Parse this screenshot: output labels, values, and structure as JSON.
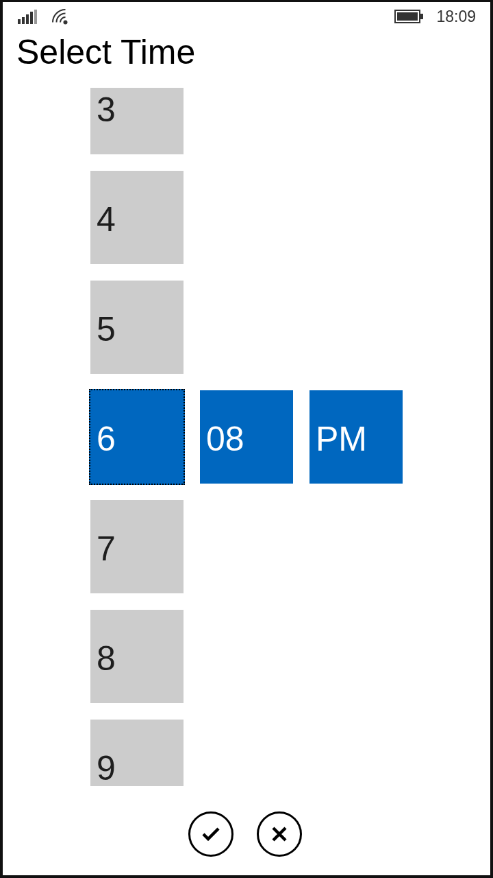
{
  "status_bar": {
    "time": "18:09"
  },
  "title": "Select Time",
  "picker": {
    "hours": [
      {
        "label": "3",
        "selected": false,
        "focused": false
      },
      {
        "label": "4",
        "selected": false,
        "focused": false
      },
      {
        "label": "5",
        "selected": false,
        "focused": false
      },
      {
        "label": "6",
        "selected": true,
        "focused": true
      },
      {
        "label": "7",
        "selected": false,
        "focused": false
      },
      {
        "label": "8",
        "selected": false,
        "focused": false
      },
      {
        "label": "9",
        "selected": false,
        "focused": false
      }
    ],
    "minutes": [
      {
        "label": "08",
        "selected": true
      }
    ],
    "periods": [
      {
        "label": "PM",
        "selected": true
      }
    ]
  },
  "buttons": [
    {
      "kind": "accept"
    },
    {
      "kind": "cancel"
    }
  ]
}
